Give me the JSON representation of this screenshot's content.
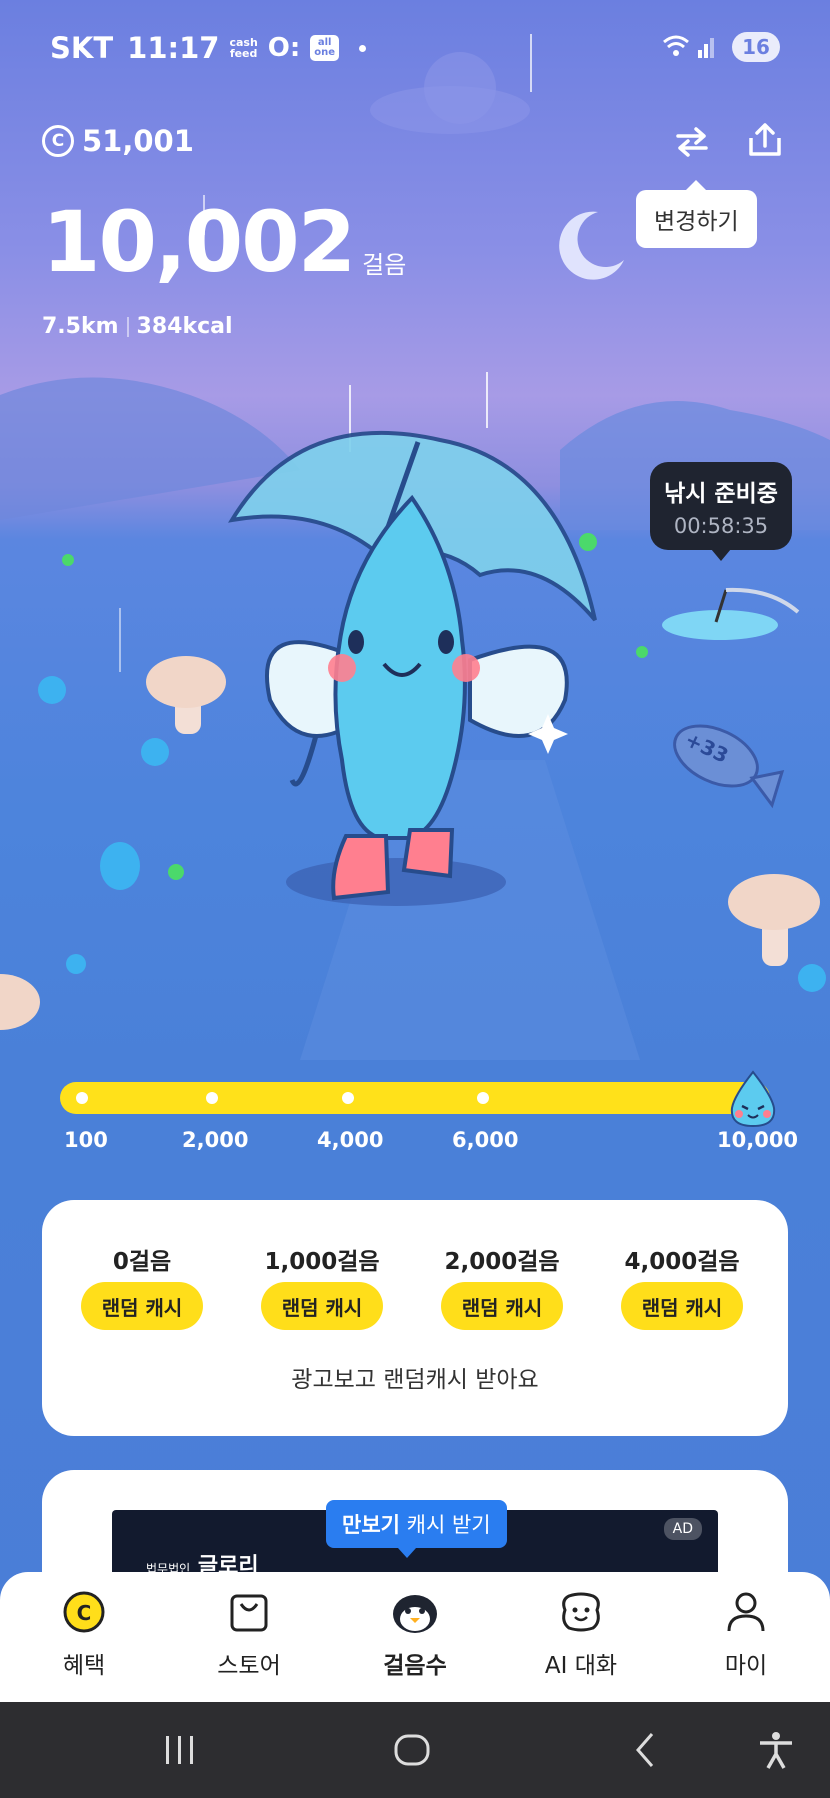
{
  "status_bar": {
    "carrier": "SKT",
    "time": "11:17",
    "cashfeed_line1": "cash",
    "cashfeed_line2": "feed",
    "oc": "O:",
    "allone_line1": "all",
    "allone_line2": "one",
    "battery": "16"
  },
  "header": {
    "cash_points": "51,001",
    "steps": "10,002",
    "steps_unit": "걸음",
    "distance": "7.5km",
    "calories": "384kcal",
    "change_tooltip": "변경하기"
  },
  "fishing": {
    "title": "낚시 준비중",
    "timer": "00:58:35"
  },
  "fish_badge": "+33",
  "progress": {
    "current_steps": 10002,
    "goal_steps": 10000,
    "labels": [
      "100",
      "2,000",
      "4,000",
      "6,000",
      "10,000"
    ]
  },
  "rewards": {
    "items": [
      {
        "steps": "0걸음",
        "button": "랜덤 캐시"
      },
      {
        "steps": "1,000걸음",
        "button": "랜덤 캐시"
      },
      {
        "steps": "2,000걸음",
        "button": "랜덤 캐시"
      },
      {
        "steps": "4,000걸음",
        "button": "랜덤 캐시"
      }
    ],
    "caption": "광고보고 랜덤캐시 받아요"
  },
  "ad": {
    "tip_bold": "만보기",
    "tip_rest": " 캐시 받기",
    "brand_small": "법무법인",
    "brand": "글로리",
    "badge": "AD"
  },
  "nav": {
    "items": [
      {
        "label": "혜택",
        "icon": "coin-icon"
      },
      {
        "label": "스토어",
        "icon": "shopping-bag-icon"
      },
      {
        "label": "걸음수",
        "icon": "penguin-icon"
      },
      {
        "label": "AI 대화",
        "icon": "smile-chat-icon"
      },
      {
        "label": "마이",
        "icon": "person-icon"
      }
    ],
    "active": "걸음수"
  },
  "colors": {
    "accent_yellow": "#ffde1a",
    "sky_top": "#6b7fe0",
    "ground_blue": "#4a80d8",
    "tooltip_dark": "#1f2430",
    "ad_tip_blue": "#2a7df0"
  }
}
